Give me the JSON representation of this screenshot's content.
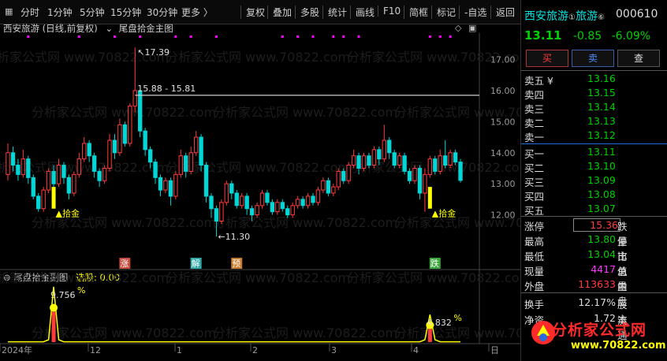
{
  "toolbar": {
    "periods": [
      "分时",
      "1分钟",
      "5分钟",
      "15分钟",
      "30分钟",
      "更多 〉"
    ],
    "actions": [
      "复权",
      "叠加",
      "多股",
      "统计",
      "画线",
      "F10",
      "简框",
      "标记",
      "-自选",
      "返回"
    ]
  },
  "chart": {
    "title": "西安旅游 (日线,前复权)",
    "indicator": "尾盘拾金主图",
    "price_axis": [
      "17.00",
      "16.00",
      "15.00",
      "14.00",
      "13.00",
      "12.00"
    ],
    "hline_label": "15.88 - 15.81",
    "high_label": "17.39",
    "low_label": "11.30",
    "signal_label": "拾金",
    "markers": [
      "涨",
      "解",
      "预",
      "跌"
    ],
    "sub_title": "尾盘拾金副图",
    "sub_select": "选股: 0.00",
    "sub_pct_1": "9.756",
    "sub_pct_2": "4.832",
    "pct_sign": "%",
    "date_labels": [
      "2024年",
      "12",
      "1",
      "2",
      "3",
      "4",
      "日"
    ]
  },
  "colors": {
    "up": "#ff3c3c",
    "down": "#00d6d6",
    "yellow": "#ffff00",
    "magenta": "#ff00ff"
  },
  "chart_data": {
    "type": "candlestick",
    "ylim": [
      11.0,
      17.8
    ],
    "candles": [
      [
        13.3,
        14.0,
        14.3,
        13.1
      ],
      [
        14.0,
        13.6,
        14.2,
        13.4
      ],
      [
        13.6,
        13.3,
        13.8,
        13.1
      ],
      [
        13.3,
        13.8,
        14.1,
        13.2
      ],
      [
        13.8,
        13.2,
        13.9,
        13.0
      ],
      [
        13.2,
        12.6,
        13.3,
        12.5
      ],
      [
        12.6,
        12.2,
        12.7,
        12.1
      ],
      [
        12.2,
        12.8,
        12.9,
        12.1
      ],
      [
        12.8,
        13.4,
        13.5,
        12.7
      ],
      [
        13.4,
        13.0,
        13.6,
        12.9
      ],
      [
        13.0,
        13.6,
        13.8,
        12.9
      ],
      [
        13.6,
        13.2,
        13.7,
        13.0
      ],
      [
        13.2,
        12.7,
        13.3,
        12.5
      ],
      [
        12.7,
        13.3,
        13.4,
        12.6
      ],
      [
        13.3,
        13.8,
        14.0,
        13.2
      ],
      [
        13.8,
        14.3,
        14.5,
        13.7
      ],
      [
        14.3,
        13.9,
        14.4,
        13.7
      ],
      [
        13.9,
        13.4,
        14.0,
        13.2
      ],
      [
        13.4,
        13.1,
        13.5,
        12.9
      ],
      [
        13.1,
        13.5,
        13.6,
        13.0
      ],
      [
        13.5,
        14.4,
        14.6,
        13.4
      ],
      [
        14.4,
        14.0,
        14.6,
        13.8
      ],
      [
        14.0,
        14.9,
        15.1,
        13.9
      ],
      [
        14.9,
        14.3,
        15.0,
        14.2
      ],
      [
        14.3,
        15.5,
        15.6,
        14.2
      ],
      [
        15.5,
        16.0,
        17.39,
        15.3
      ],
      [
        16.0,
        14.7,
        15.9,
        14.5
      ],
      [
        14.7,
        14.1,
        14.8,
        13.9
      ],
      [
        14.1,
        13.7,
        14.2,
        13.5
      ],
      [
        13.7,
        13.2,
        13.8,
        13.0
      ],
      [
        13.2,
        12.8,
        13.3,
        12.6
      ],
      [
        12.8,
        13.1,
        13.2,
        12.7
      ],
      [
        13.1,
        12.6,
        13.2,
        12.3
      ],
      [
        12.6,
        13.3,
        13.4,
        12.5
      ],
      [
        13.3,
        13.9,
        14.1,
        13.2
      ],
      [
        13.9,
        13.4,
        14.0,
        13.2
      ],
      [
        13.4,
        14.0,
        14.2,
        13.3
      ],
      [
        14.0,
        14.5,
        14.7,
        13.9
      ],
      [
        14.5,
        13.6,
        14.6,
        13.4
      ],
      [
        13.6,
        12.6,
        13.7,
        12.4
      ],
      [
        12.6,
        12.2,
        12.7,
        11.9
      ],
      [
        12.2,
        11.8,
        12.3,
        11.3
      ],
      [
        11.8,
        12.4,
        12.5,
        11.7
      ],
      [
        12.4,
        13.0,
        13.1,
        12.3
      ],
      [
        13.0,
        12.7,
        13.1,
        12.5
      ],
      [
        12.7,
        12.3,
        12.8,
        12.2
      ],
      [
        12.3,
        12.6,
        12.7,
        12.2
      ],
      [
        12.6,
        12.2,
        12.7,
        12.0
      ],
      [
        12.2,
        12.0,
        12.3,
        11.8
      ],
      [
        12.0,
        12.3,
        12.4,
        11.9
      ],
      [
        12.3,
        12.7,
        12.8,
        12.2
      ],
      [
        12.7,
        12.4,
        12.8,
        12.3
      ],
      [
        12.4,
        12.1,
        12.5,
        12.0
      ],
      [
        12.1,
        12.4,
        12.5,
        12.0
      ],
      [
        12.4,
        12.2,
        12.5,
        12.1
      ],
      [
        12.2,
        12.0,
        12.3,
        11.9
      ],
      [
        12.0,
        12.3,
        12.4,
        11.9
      ],
      [
        12.3,
        12.5,
        12.6,
        12.2
      ],
      [
        12.5,
        12.3,
        12.6,
        12.2
      ],
      [
        12.3,
        12.6,
        12.7,
        12.2
      ],
      [
        12.6,
        12.4,
        12.7,
        12.3
      ],
      [
        12.4,
        12.8,
        12.9,
        12.3
      ],
      [
        12.8,
        13.1,
        13.2,
        12.7
      ],
      [
        13.1,
        12.7,
        13.2,
        12.6
      ],
      [
        12.7,
        12.9,
        13.0,
        12.6
      ],
      [
        12.9,
        13.4,
        13.5,
        12.8
      ],
      [
        13.4,
        13.1,
        13.5,
        13.0
      ],
      [
        13.1,
        13.6,
        13.7,
        13.0
      ],
      [
        13.6,
        13.9,
        14.1,
        13.5
      ],
      [
        13.9,
        13.5,
        14.0,
        13.3
      ],
      [
        13.5,
        13.9,
        14.0,
        13.4
      ],
      [
        13.9,
        13.6,
        14.0,
        13.5
      ],
      [
        13.6,
        14.1,
        14.2,
        13.5
      ],
      [
        14.1,
        13.8,
        14.2,
        13.6
      ],
      [
        13.8,
        14.4,
        14.9,
        13.7
      ],
      [
        14.4,
        14.0,
        14.5,
        13.8
      ],
      [
        14.0,
        13.6,
        14.1,
        13.5
      ],
      [
        13.6,
        13.9,
        14.0,
        13.5
      ],
      [
        13.9,
        13.4,
        14.0,
        13.3
      ],
      [
        13.4,
        13.1,
        13.5,
        13.0
      ],
      [
        13.1,
        13.5,
        13.6,
        13.0
      ],
      [
        13.5,
        12.7,
        13.6,
        12.5
      ],
      [
        12.7,
        13.3,
        13.5,
        12.1
      ],
      [
        13.3,
        13.8,
        13.9,
        13.2
      ],
      [
        13.8,
        13.4,
        13.9,
        13.3
      ],
      [
        13.4,
        13.9,
        14.1,
        13.3
      ],
      [
        13.9,
        13.6,
        14.4,
        13.5
      ],
      [
        13.6,
        14.0,
        14.1,
        13.5
      ],
      [
        14.0,
        13.7,
        14.1,
        13.6
      ],
      [
        13.7,
        13.11,
        13.8,
        13.04
      ]
    ],
    "hline": 15.85,
    "sub_spikes": [
      {
        "index": 9,
        "value": 9.756
      },
      {
        "index": 83,
        "value": 4.832
      }
    ]
  },
  "quote": {
    "name": "西安旅游",
    "sup": "①",
    "sup2": "⑥",
    "code": "000610",
    "price": "13.11",
    "change": "-0.85",
    "pct": "-6.09%",
    "buy_btn": "买",
    "sell_btn": "卖",
    "query_btn": "查",
    "sells": [
      {
        "label": "卖五 ¥",
        "value": "13.16"
      },
      {
        "label": "卖四",
        "value": "13.15"
      },
      {
        "label": "卖三",
        "value": "13.14"
      },
      {
        "label": "卖二",
        "value": "13.13"
      },
      {
        "label": "卖一",
        "value": "13.12"
      }
    ],
    "buys": [
      {
        "label": "买一",
        "value": "13.11"
      },
      {
        "label": "买二",
        "value": "13.10"
      },
      {
        "label": "买三",
        "value": "13.09"
      },
      {
        "label": "买四",
        "value": "13.08"
      },
      {
        "label": "买五",
        "value": "13.07"
      }
    ],
    "stats": [
      {
        "l1": "涨停",
        "v": "15.36",
        "c": "red",
        "l2": "跌停"
      },
      {
        "l1": "最高",
        "v": "13.80",
        "c": "green",
        "l2": "量比"
      },
      {
        "l1": "最低",
        "v": "13.04",
        "c": "green",
        "l2": "市值"
      },
      {
        "l1": "现量",
        "v": "4417",
        "c": "magenta",
        "l2": "总量"
      },
      {
        "l1": "外盘",
        "v": "113633",
        "c": "red",
        "l2": "内盘"
      }
    ],
    "turnover_label": "换手",
    "turnover_value": "12.17%",
    "turnover_l2": "股本",
    "float_label": "净资",
    "float_value": "1.72",
    "float_l2": "流通"
  },
  "watermark": "分析家公式网 www.70822.com",
  "brand": {
    "name": "分析家公式网",
    "url": "www.70822.com"
  }
}
